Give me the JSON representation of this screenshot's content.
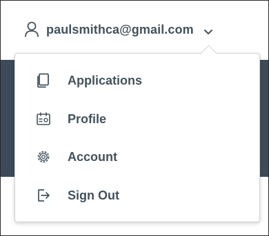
{
  "header": {
    "user_email": "paulsmithca@gmail.com",
    "user_icon": "user-icon",
    "toggle_icon": "chevron-down-icon"
  },
  "menu": {
    "items": [
      {
        "label": "Applications",
        "icon": "applications-icon"
      },
      {
        "label": "Profile",
        "icon": "profile-icon"
      },
      {
        "label": "Account",
        "icon": "gear-icon"
      },
      {
        "label": "Sign Out",
        "icon": "sign-out-icon"
      }
    ]
  },
  "colors": {
    "text": "#44525c",
    "band": "#3c4a5a",
    "menu_border": "#cfd3d6"
  }
}
